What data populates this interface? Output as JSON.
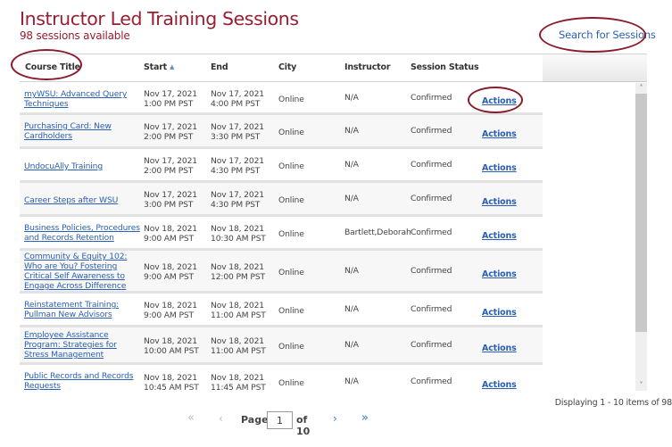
{
  "header": {
    "title": "Instructor Led Training Sessions",
    "subtitle": "98 sessions available",
    "search_link": "Search for Sessions"
  },
  "grid": {
    "columns": [
      {
        "label": "Course Title"
      },
      {
        "label": "Start",
        "sort": "ascending",
        "sort_icon": "▲"
      },
      {
        "label": "End"
      },
      {
        "label": "City"
      },
      {
        "label": "Instructor"
      },
      {
        "label": "Session Status"
      }
    ],
    "rows": [
      {
        "title": "myWSU: Advanced Query Techniques",
        "start_date": "Nov 17, 2021",
        "start_time": "1:00 PM PST",
        "end_date": "Nov 17, 2021",
        "end_time": "4:00 PM PST",
        "city": "Online",
        "instructor": "N/A",
        "status": "Confirmed",
        "action": "Actions"
      },
      {
        "title": "Purchasing Card: New Cardholders",
        "start_date": "Nov 17, 2021",
        "start_time": "2:00 PM PST",
        "end_date": "Nov 17, 2021",
        "end_time": "3:30 PM PST",
        "city": "Online",
        "instructor": "N/A",
        "status": "Confirmed",
        "action": "Actions"
      },
      {
        "title": "UndocuAlly Training",
        "start_date": "Nov 17, 2021",
        "start_time": "2:00 PM PST",
        "end_date": "Nov 17, 2021",
        "end_time": "4:30 PM PST",
        "city": "Online",
        "instructor": "N/A",
        "status": "Confirmed",
        "action": "Actions"
      },
      {
        "title": "Career Steps after WSU",
        "start_date": "Nov 17, 2021",
        "start_time": "3:00 PM PST",
        "end_date": "Nov 17, 2021",
        "end_time": "4:30 PM PST",
        "city": "Online",
        "instructor": "N/A",
        "status": "Confirmed",
        "action": "Actions"
      },
      {
        "title": "Business Policies, Procedures and Records Retention",
        "start_date": "Nov 18, 2021",
        "start_time": "9:00 AM PST",
        "end_date": "Nov 18, 2021",
        "end_time": "10:30 AM PST",
        "city": "Online",
        "instructor": "Bartlett,Deborah",
        "status": "Confirmed",
        "action": "Actions"
      },
      {
        "title": "Community & Equity 102: Who are You? Fostering Critical Self Awareness to Engage Across Difference",
        "start_date": "Nov 18, 2021",
        "start_time": "9:00 AM PST",
        "end_date": "Nov 18, 2021",
        "end_time": "12:00 PM PST",
        "city": "Online",
        "instructor": "N/A",
        "status": "Confirmed",
        "action": "Actions"
      },
      {
        "title": "Reinstatement Training: Pullman New Advisors",
        "start_date": "Nov 18, 2021",
        "start_time": "9:00 AM PST",
        "end_date": "Nov 18, 2021",
        "end_time": "11:00 AM PST",
        "city": "Online",
        "instructor": "N/A",
        "status": "Confirmed",
        "action": "Actions"
      },
      {
        "title": "Employee Assistance Program: Strategies for Stress Management",
        "start_date": "Nov 18, 2021",
        "start_time": "10:00 AM PST",
        "end_date": "Nov 18, 2021",
        "end_time": "11:00 AM PST",
        "city": "Online",
        "instructor": "N/A",
        "status": "Confirmed",
        "action": "Actions"
      },
      {
        "title": "Public Records and Records Requests",
        "start_date": "Nov 18, 2021",
        "start_time": "10:45 AM PST",
        "end_date": "Nov 18, 2021",
        "end_time": "11:45 AM PST",
        "city": "Online",
        "instructor": "N/A",
        "status": "Confirmed",
        "action": "Actions"
      }
    ]
  },
  "scrollbar": {
    "up_icon": "˄",
    "down_icon": "˅"
  },
  "footer": {
    "displaying": "Displaying 1 - 10 items of 98",
    "pager": {
      "first_icon": "«",
      "prev_icon": "‹",
      "page_label": "Page",
      "current_page": "1",
      "of_label": "of 10",
      "next_icon": "›",
      "last_icon": "»"
    }
  },
  "colors": {
    "brand": "#981e32",
    "link": "#2b5fb3",
    "annotation": "#8b1a2b"
  }
}
